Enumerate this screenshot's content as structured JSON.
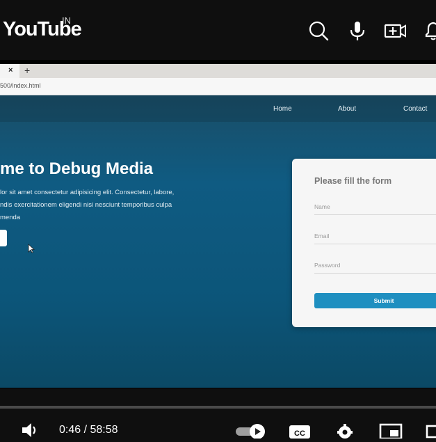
{
  "header": {
    "logo": "YouTube",
    "region": "IN",
    "icons": [
      "search-icon",
      "microphone-icon",
      "create-icon",
      "notifications-icon"
    ]
  },
  "browser": {
    "tab_close": "×",
    "new_tab": "+",
    "url": "500/index.html"
  },
  "site": {
    "nav": [
      "Home",
      "About",
      "Contact"
    ],
    "hero_title": "me to Debug Media",
    "hero_lines": [
      "lor sit amet consectetur adipisicing elit. Consectetur, labore,",
      "ndis exercitationem eligendi nisi nesciunt temporibus culpa",
      "menda"
    ],
    "form": {
      "title": "Please fill the form",
      "name_placeholder": "Name",
      "email_placeholder": "Email",
      "password_placeholder": "Password",
      "submit_label": "Submit"
    }
  },
  "player": {
    "time": "0:46 / 58:58",
    "icons": [
      "volume-icon",
      "autoplay-toggle-icon",
      "captions-icon",
      "settings-icon",
      "miniplayer-icon",
      "theater-icon"
    ]
  },
  "colors": {
    "accent": "#1f8fc0",
    "site_bg": "#0f5b82"
  }
}
